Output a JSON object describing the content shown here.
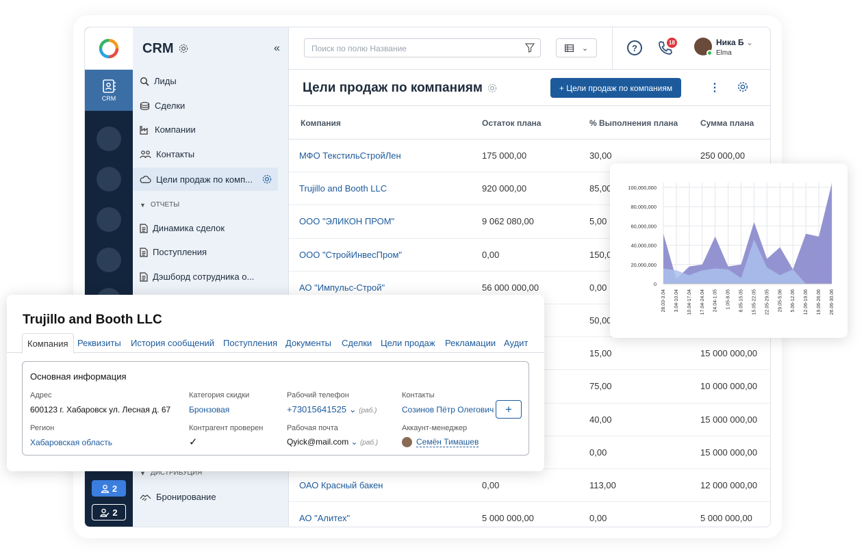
{
  "app": {
    "title": "CRM",
    "collapse": "«"
  },
  "rail": {
    "active_label": "CRM",
    "badge1": "2",
    "badge2": "2"
  },
  "sidebar": {
    "items": [
      {
        "label": "Лиды",
        "icon": "search-icon"
      },
      {
        "label": "Сделки",
        "icon": "coins-icon"
      },
      {
        "label": "Компании",
        "icon": "factory-icon"
      },
      {
        "label": "Контакты",
        "icon": "people-icon"
      },
      {
        "label": "Цели продаж по комп...",
        "icon": "cloud-icon"
      }
    ],
    "section_reports": "ОТЧЕТЫ",
    "reports": [
      "Динамика сделок",
      "Поступления",
      "Дэшборд сотрудника о..."
    ],
    "section_distribution": "ДИСТРИБУЦИЯ",
    "booking": "Бронирование"
  },
  "topbar": {
    "search_placeholder": "Поиск по полю Название",
    "calls_badge": "18",
    "user_name": "Ника Б",
    "user_org": "Elma",
    "help": "?"
  },
  "page": {
    "title": "Цели продаж по компаниям",
    "add_button": "+ Цели продаж по компаниям",
    "more": "⋮"
  },
  "table": {
    "headers": [
      "Компания",
      "Остаток плана",
      "% Выполнения плана",
      "Сумма плана"
    ],
    "rows": [
      [
        "МФО ТекстильСтройЛен",
        "175 000,00",
        "30,00",
        "250 000,00"
      ],
      [
        "Trujillo and Booth LLC",
        "920 000,00",
        "85,00",
        ""
      ],
      [
        "ООО \"ЭЛИКОН ПРОМ\"",
        "9 062 080,00",
        "5,00",
        ""
      ],
      [
        "ООО \"СтройИнвесПром\"",
        "0,00",
        "150,00",
        ""
      ],
      [
        "АО \"Импульс-Строй\"",
        "56 000 000,00",
        "0,00",
        ""
      ],
      [
        "",
        "",
        "50,00",
        ""
      ],
      [
        "",
        "",
        "15,00",
        "15 000 000,00"
      ],
      [
        "",
        "",
        "75,00",
        "10 000 000,00"
      ],
      [
        "",
        "",
        "40,00",
        "15 000 000,00"
      ],
      [
        "",
        "",
        "0,00",
        "15 000 000,00"
      ],
      [
        "ОАО Красный бакен",
        "0,00",
        "113,00",
        "12 000 000,00"
      ],
      [
        "АО \"Алитех\"",
        "5 000 000,00",
        "0,00",
        "5 000 000,00"
      ]
    ]
  },
  "chart_data": {
    "type": "area",
    "x": [
      "28.03-3.04",
      "3.04-10.04",
      "10.04-17.04",
      "17.04-24.04",
      "24.04-1.05",
      "1.05-8.05",
      "8.05-15.05",
      "15.05-22.05",
      "22.05-29.05",
      "29.05-5.06",
      "5.06-12.06",
      "12.06-19.06",
      "19.06-26.06",
      "26.06-30.06"
    ],
    "series": [
      {
        "values": [
          52000000,
          5000000,
          18000000,
          20000000,
          49000000,
          18000000,
          20000000,
          64000000,
          26000000,
          38000000,
          15000000,
          52000000,
          49000000,
          104000000
        ],
        "color": "#8e8dcf"
      },
      {
        "values": [
          16000000,
          14000000,
          9000000,
          14000000,
          16000000,
          15000000,
          6000000,
          46000000,
          17000000,
          9000000,
          15000000,
          0,
          0,
          0
        ],
        "color": "#a9c0ec"
      }
    ],
    "yticks": [
      "0",
      "20,000,000",
      "40,000,000",
      "60,000,000",
      "80,000,000",
      "100,000,000"
    ],
    "ylim": [
      0,
      105000000
    ],
    "grid": true
  },
  "company_card": {
    "title": "Trujillo and Booth LLC",
    "tabs": [
      "Компания",
      "Реквизиты",
      "История сообщений",
      "Поступления",
      "Документы",
      "Сделки",
      "Цели продаж",
      "Рекламации",
      "Аудит"
    ],
    "section_title": "Основная информация",
    "address_label": "Адрес",
    "address": "600123 г. Хабаровск ул. Лесная д. 67",
    "discount_label": "Категория скидки",
    "discount": "Бронзовая",
    "phone_label": "Рабочий телефон",
    "phone": "+73015641525",
    "phone_tag": "(раб.)",
    "contacts_label": "Контакты",
    "contact": "Созинов Пётр Олегович",
    "region_label": "Регион",
    "region": "Хабаровская область",
    "verified_label": "Контрагент проверен",
    "verified": "✓",
    "email_label": "Рабочая почта",
    "email": "Qyick@mail.com",
    "email_tag": "(раб.)",
    "manager_label": "Аккаунт-менеджер",
    "manager": "Семён Тимашев",
    "add": "+"
  }
}
